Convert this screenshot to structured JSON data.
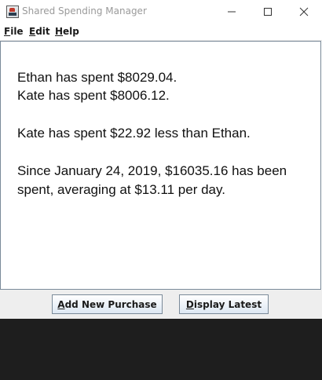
{
  "window": {
    "title": "Shared Spending Manager",
    "icon": "app-icon"
  },
  "menu": {
    "file": {
      "mnemonic": "F",
      "rest": "ile"
    },
    "edit": {
      "mnemonic": "E",
      "rest": "dit"
    },
    "help": {
      "mnemonic": "H",
      "rest": "elp"
    }
  },
  "summary": {
    "line1": "Ethan has spent $8029.04.",
    "line2": "Kate has spent $8006.12.",
    "line3": "Kate has spent $22.92 less than Ethan.",
    "line4": "Since January 24, 2019, $16035.16 has been",
    "line5": "spent, averaging at $13.11 per day."
  },
  "buttons": {
    "add": {
      "mnemonic": "A",
      "rest": "dd New Purchase"
    },
    "latest": {
      "mnemonic": "D",
      "rest": "isplay Latest"
    }
  },
  "colors": {
    "title_text": "#9a9a9a",
    "content_border": "#7a8a99",
    "button_bar": "#eeeeee",
    "desktop": "#1e1e1e"
  }
}
